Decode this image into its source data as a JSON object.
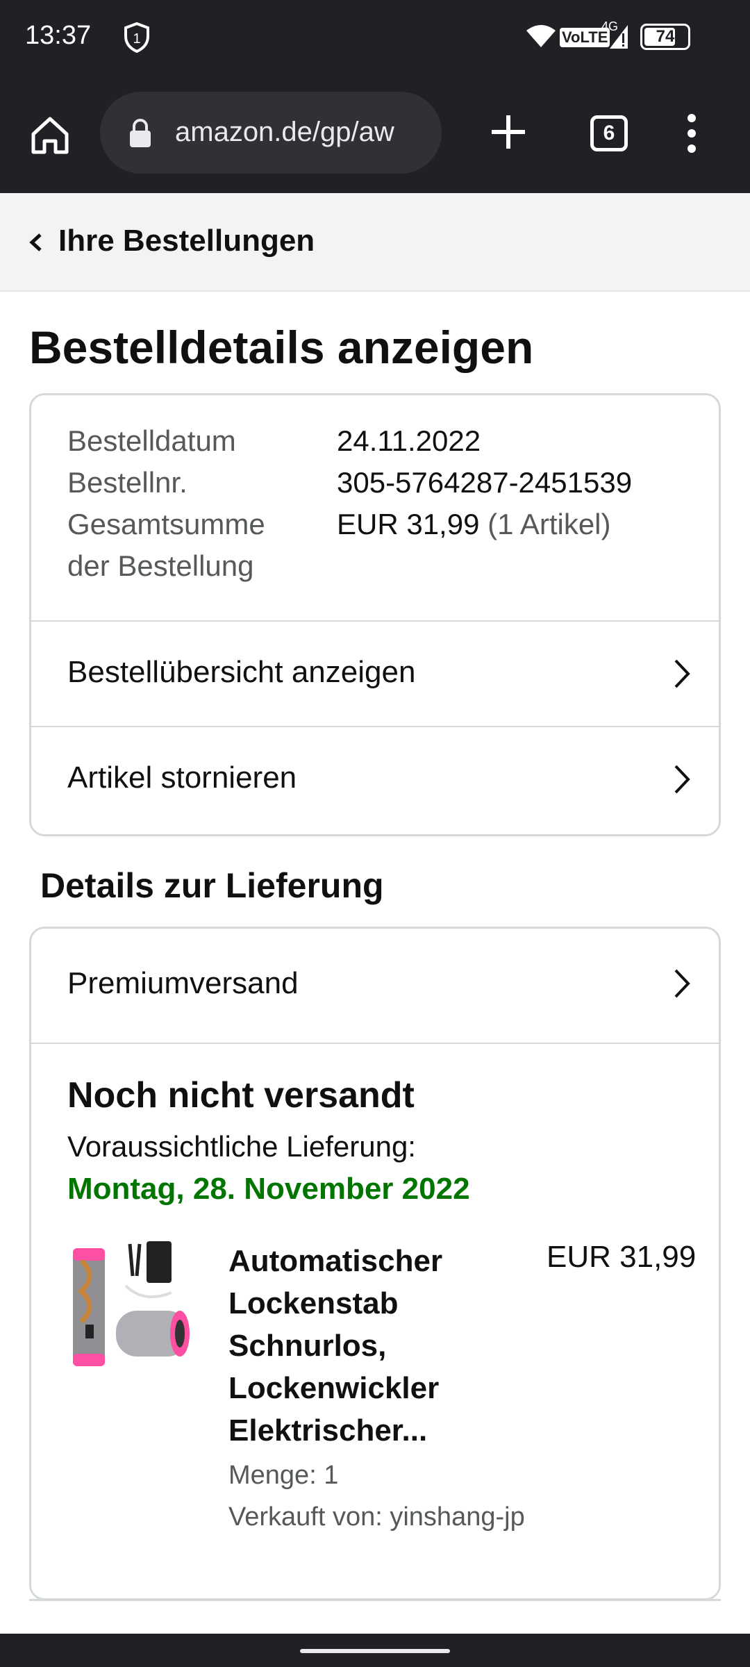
{
  "status_bar": {
    "time": "13:37",
    "notification_badge": "1",
    "network_label": "VoLTE",
    "network_type": "4G",
    "battery": "74",
    "battery_level": 0.74,
    "icons": [
      "shield-icon",
      "wifi-icon",
      "signal-icon",
      "battery-icon"
    ]
  },
  "browser": {
    "url": "amazon.de/gp/aw",
    "tab_count": "6",
    "icons": [
      "home-icon",
      "lock-icon",
      "plus-icon",
      "tabs-icon",
      "more-vert-icon"
    ]
  },
  "navbar": {
    "back_label": "Ihre Bestellungen"
  },
  "page": {
    "title": "Bestelldetails anzeigen"
  },
  "order_summary": {
    "date_label": "Bestelldatum",
    "date_value": "24.11.2022",
    "number_label": "Bestellnr.",
    "number_value": "305-5764287-2451539",
    "total_label_line1": "Gesamtsumme",
    "total_label_line2": "der Bestellung",
    "total_value": "EUR 31,99",
    "total_items": "(1 Artikel)"
  },
  "actions": {
    "view_summary": "Bestellübersicht anzeigen",
    "cancel_items": "Artikel stornieren"
  },
  "delivery": {
    "section_title": "Details zur Lieferung",
    "shipping_method": "Premiumversand",
    "status": "Noch nicht versandt",
    "eta_label": "Voraussichtliche Lieferung:",
    "eta_date": "Montag, 28. November 2022"
  },
  "product": {
    "title_lines": [
      "Automatischer",
      "Lockenstab",
      "Schnurlos,",
      "Lockenwickler",
      "Elektrischer..."
    ],
    "price": "EUR 31,99",
    "quantity": "Menge: 1",
    "seller": "Verkauft von: yinshang-jp"
  },
  "colors": {
    "toolbar_bg": "#202124",
    "delivery_green": "#007600",
    "text": "#0f1111",
    "muted": "#565959"
  }
}
